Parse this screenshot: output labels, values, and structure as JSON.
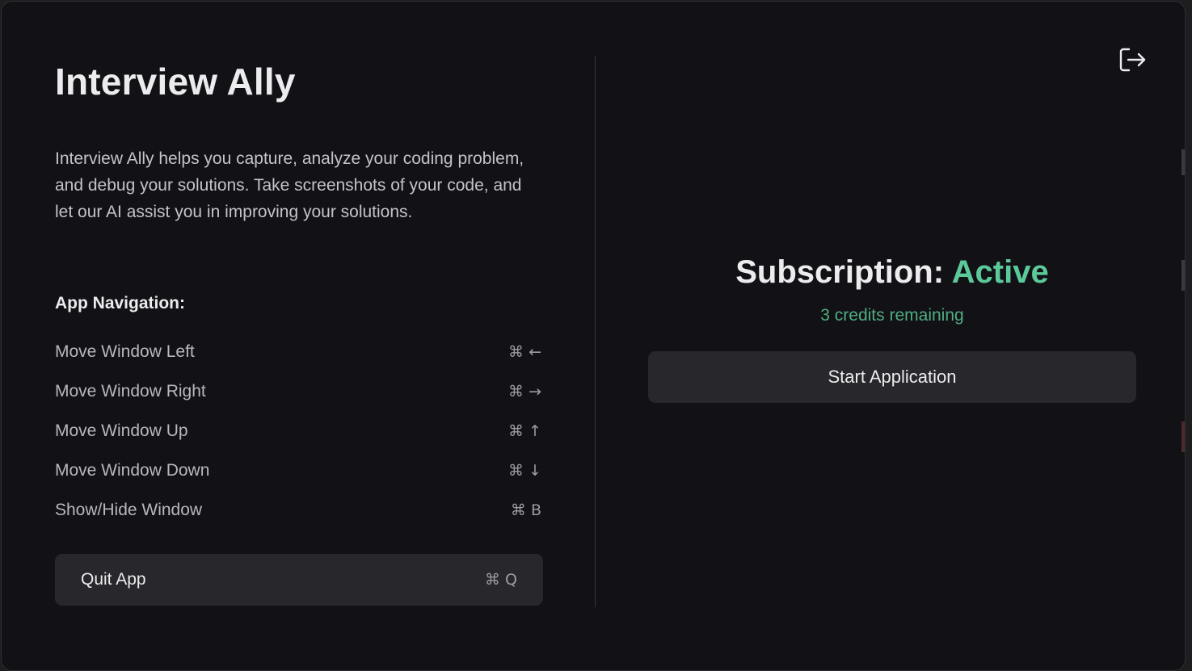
{
  "app": {
    "title": "Interview Ally",
    "description": "Interview Ally helps you capture, analyze your coding problem, and debug your solutions. Take screenshots of your code, and let our AI assist you in improving your solutions."
  },
  "navigation": {
    "heading": "App Navigation:",
    "items": [
      {
        "label": "Move Window Left",
        "shortcut": "⌘ ←"
      },
      {
        "label": "Move Window Right",
        "shortcut": "⌘ →"
      },
      {
        "label": "Move Window Up",
        "shortcut": "⌘ ↑"
      },
      {
        "label": "Move Window Down",
        "shortcut": "⌘ ↓"
      },
      {
        "label": "Show/Hide Window",
        "shortcut": "⌘ B"
      }
    ]
  },
  "quit": {
    "label": "Quit App",
    "shortcut": "⌘ Q"
  },
  "subscription": {
    "label": "Subscription:",
    "status": "Active",
    "credits_text": "3 credits remaining"
  },
  "actions": {
    "start_label": "Start Application",
    "logout_icon": "logout-icon"
  },
  "colors": {
    "background": "#121116",
    "accent_green": "#5cc99a",
    "button_bg": "#27272c"
  }
}
